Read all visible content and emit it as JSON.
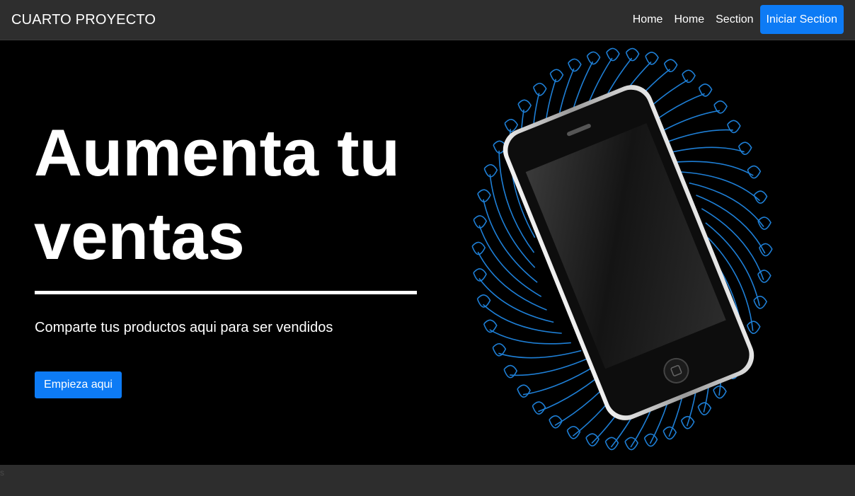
{
  "navbar": {
    "brand": "CUARTO PROYECTO",
    "links": [
      "Home",
      "Home",
      "Section"
    ],
    "login_button": "Iniciar Section"
  },
  "hero": {
    "title": "Aumenta tu ventas",
    "subtitle": "Comparte tus productos aqui para ser vendidos",
    "cta_button": "Empieza aqui",
    "image": "smartphone-with-blue-spirograph-illustration"
  },
  "footer": {
    "mark": "s"
  },
  "colors": {
    "accent": "#0d7bf5",
    "navbar_bg": "#2e2e2e",
    "hero_bg": "#000000",
    "spiral": "#1e7fd6"
  }
}
